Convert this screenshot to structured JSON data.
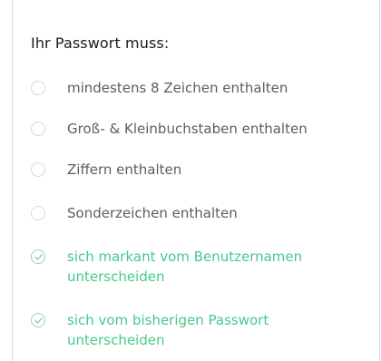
{
  "heading": "Ihr Passwort muss:",
  "requirements": [
    {
      "text": "mindestens 8 Zeichen enthalten",
      "met": false
    },
    {
      "text": "Groß- & Kleinbuchstaben enthalten",
      "met": false
    },
    {
      "text": "Ziffern enthalten",
      "met": false
    },
    {
      "text": "Sonderzeichen enthalten",
      "met": false
    },
    {
      "text": "sich markant vom Benutzernamen unterscheiden",
      "met": true
    },
    {
      "text": "sich vom bisherigen Passwort unterscheiden",
      "met": true
    }
  ],
  "colors": {
    "unmet_text": "#5d5d5d",
    "met_text": "#45c98a",
    "unmet_circle": "#d9d9d9",
    "met_circle": "#8fd8b0"
  },
  "icons": {
    "unmet": "empty-circle-icon",
    "met": "check-circle-icon"
  }
}
